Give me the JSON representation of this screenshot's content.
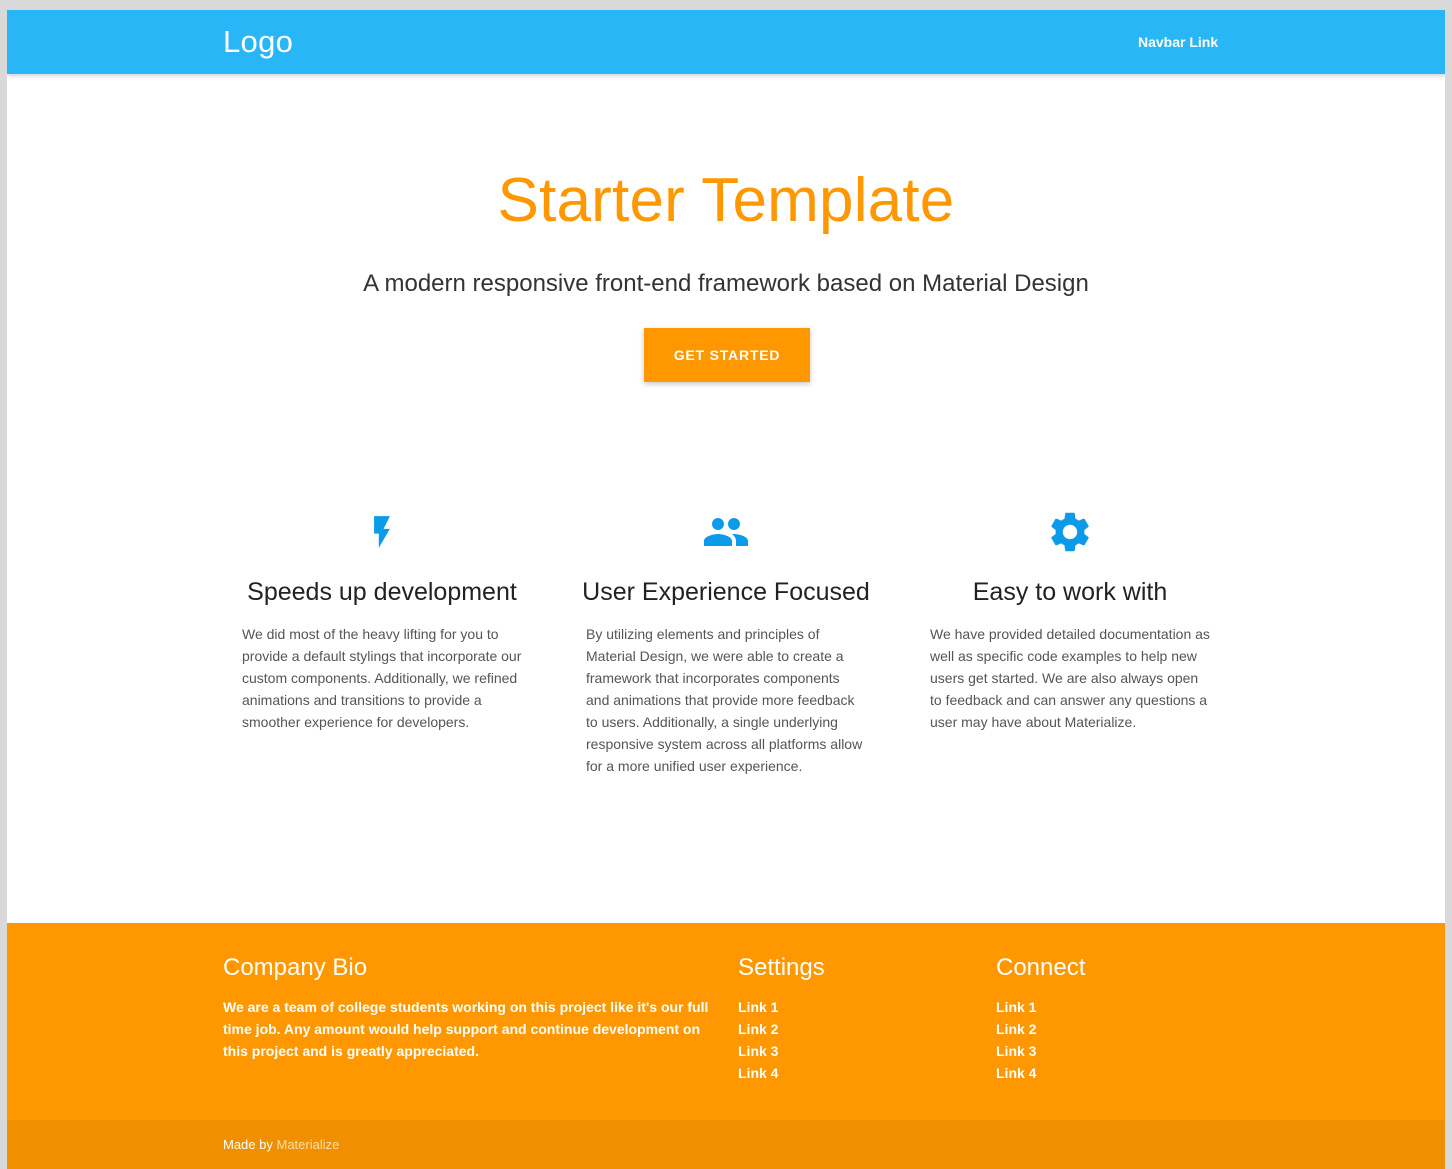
{
  "colors": {
    "navbar": "#29b6f6",
    "accent": "#ff9800",
    "icon": "#0b9be8",
    "footer_bottom": "#f08f00"
  },
  "navbar": {
    "logo": "Logo",
    "link": "Navbar Link"
  },
  "hero": {
    "title": "Starter Template",
    "subtitle": "A modern responsive front-end framework based on Material Design",
    "button": "GET STARTED"
  },
  "features": [
    {
      "icon": "flash-icon",
      "title": "Speeds up development",
      "text": "We did most of the heavy lifting for you to provide a default stylings that incorporate our custom components. Additionally, we refined animations and transitions to provide a smoother experience for developers."
    },
    {
      "icon": "group-icon",
      "title": "User Experience Focused",
      "text": "By utilizing elements and principles of Material Design, we were able to create a framework that incorporates components and animations that provide more feedback to users. Additionally, a single underlying responsive system across all platforms allow for a more unified user experience."
    },
    {
      "icon": "settings-icon",
      "title": "Easy to work with",
      "text": "We have provided detailed documentation as well as specific code examples to help new users get started. We are also always open to feedback and can answer any questions a user may have about Materialize."
    }
  ],
  "footer": {
    "bio": {
      "title": "Company Bio",
      "text": "We are a team of college students working on this project like it's our full time job. Any amount would help support and continue development on this project and is greatly appreciated."
    },
    "settings": {
      "title": "Settings",
      "links": [
        "Link 1",
        "Link 2",
        "Link 3",
        "Link 4"
      ]
    },
    "connect": {
      "title": "Connect",
      "links": [
        "Link 1",
        "Link 2",
        "Link 3",
        "Link 4"
      ]
    },
    "copyright": {
      "prefix": "Made by ",
      "link": "Materialize"
    }
  }
}
